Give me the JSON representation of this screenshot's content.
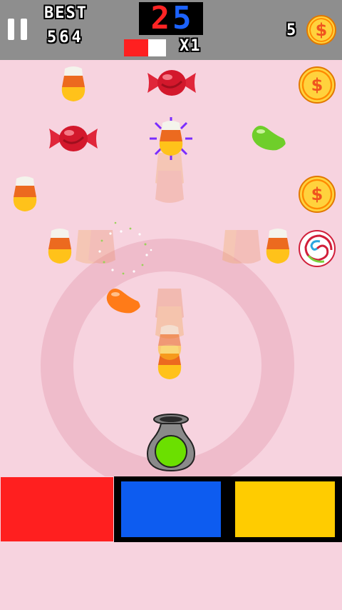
{
  "hud": {
    "best_label": "BEST",
    "best_value": "564",
    "score_tens": "2",
    "score_ones": "5",
    "combo_progress": 0.57,
    "multiplier": "X1",
    "coin_count": "5",
    "coin_symbol": "$"
  },
  "colors": {
    "red": "#ff1f1f",
    "blue": "#0d5cf0",
    "yellow": "#ffcc00",
    "pot_ball": "#6be000",
    "background": "#f7d3df"
  },
  "field": {
    "coin_symbol": "$"
  },
  "buttons": [
    {
      "name": "red-color-button",
      "color": "red"
    },
    {
      "name": "blue-color-button",
      "color": "blue"
    },
    {
      "name": "yellow-color-button",
      "color": "yellow"
    }
  ]
}
